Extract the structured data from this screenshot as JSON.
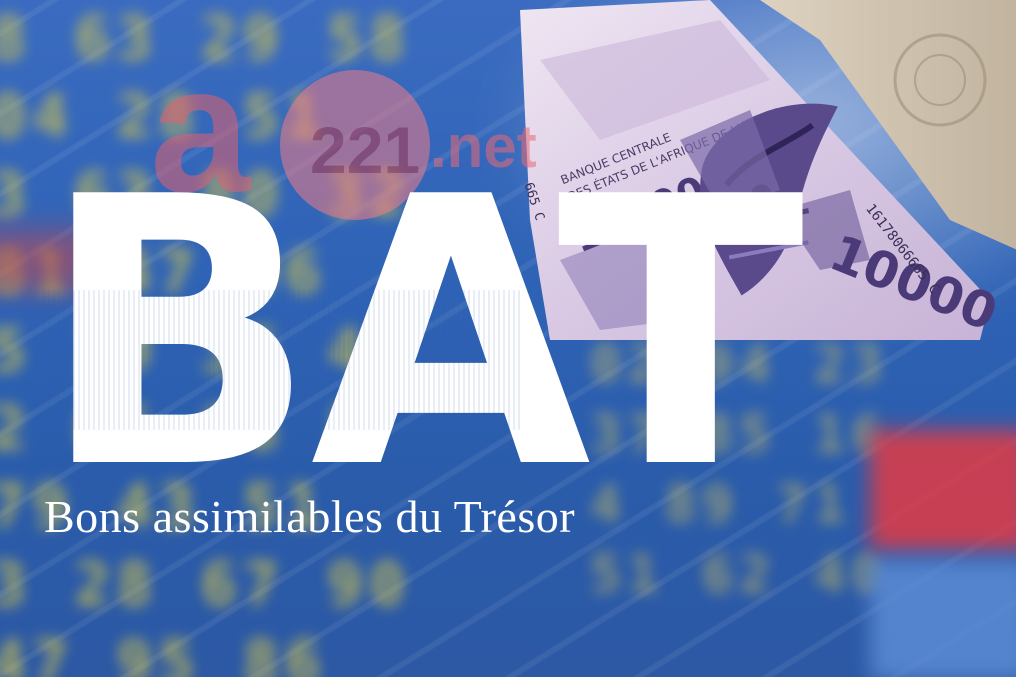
{
  "heading": "BAT",
  "subtitle": "Bons assimilables du Trésor",
  "logo": {
    "letter": "a",
    "number": "221",
    "suffix": ".net"
  },
  "banknote": {
    "issuer_line1": "BANQUE CENTRALE",
    "issuer_line2": "DES ÉTATS DE L'AFRIQUE DE L'OUEST",
    "denomination": "10000",
    "serial": "16178066665 C",
    "side_code": "665 C"
  },
  "ticker_left_rows": [
    "8 63 29 58",
    "04 28 51",
    "3 63 80 32",
    "81 47 96",
    "5 19 36 41",
    "2 65 06 8",
    "79 43 51",
    "3 28 67 90",
    "47 95 86"
  ],
  "ticker_right_rows": [
    "02 94 23",
    "37 85 16",
    "4 89 71",
    "51 62 40"
  ],
  "colors": {
    "background": "#2f63b6",
    "heading": "#ffffff",
    "logo_accent": "#e2616f",
    "ticker_yellow": "#d8c84a",
    "ticker_red": "#e23b45"
  }
}
